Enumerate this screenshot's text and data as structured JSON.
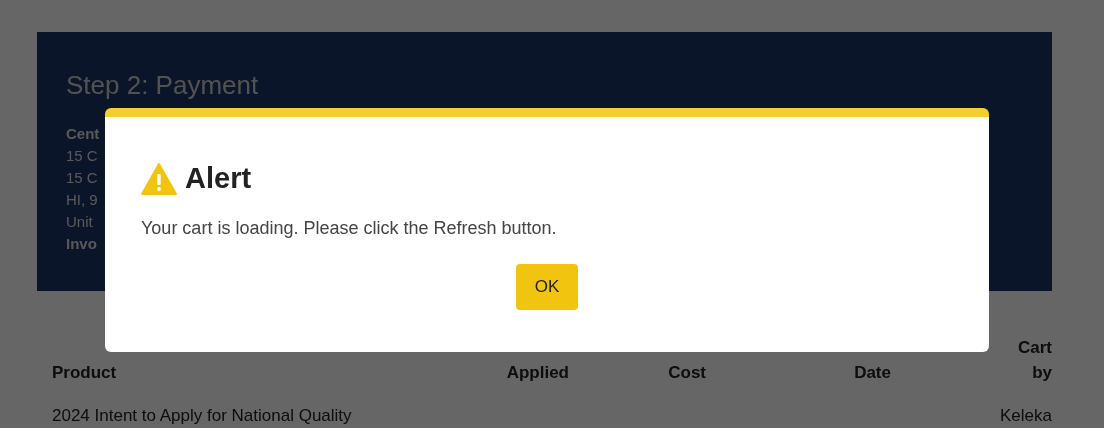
{
  "payment_panel": {
    "title": "Step 2: Payment",
    "lines": [
      {
        "text": "Cent",
        "kind": "label"
      },
      {
        "text": "15 C",
        "kind": "text"
      },
      {
        "text": "15 C",
        "kind": "text"
      },
      {
        "text": "HI, 9",
        "kind": "text"
      },
      {
        "text": "Unit",
        "kind": "text"
      },
      {
        "text": "Invo",
        "kind": "label"
      }
    ]
  },
  "table": {
    "columns": [
      "Product",
      "Applied",
      "Cost",
      "Date",
      "Cart by"
    ],
    "rows": [
      [
        "2024 Intent to Apply for National Quality",
        "",
        "",
        "",
        "Keleka"
      ]
    ]
  },
  "dialog": {
    "title": "Alert",
    "message": "Your cart is loading. Please click the Refresh button.",
    "button": "OK"
  }
}
